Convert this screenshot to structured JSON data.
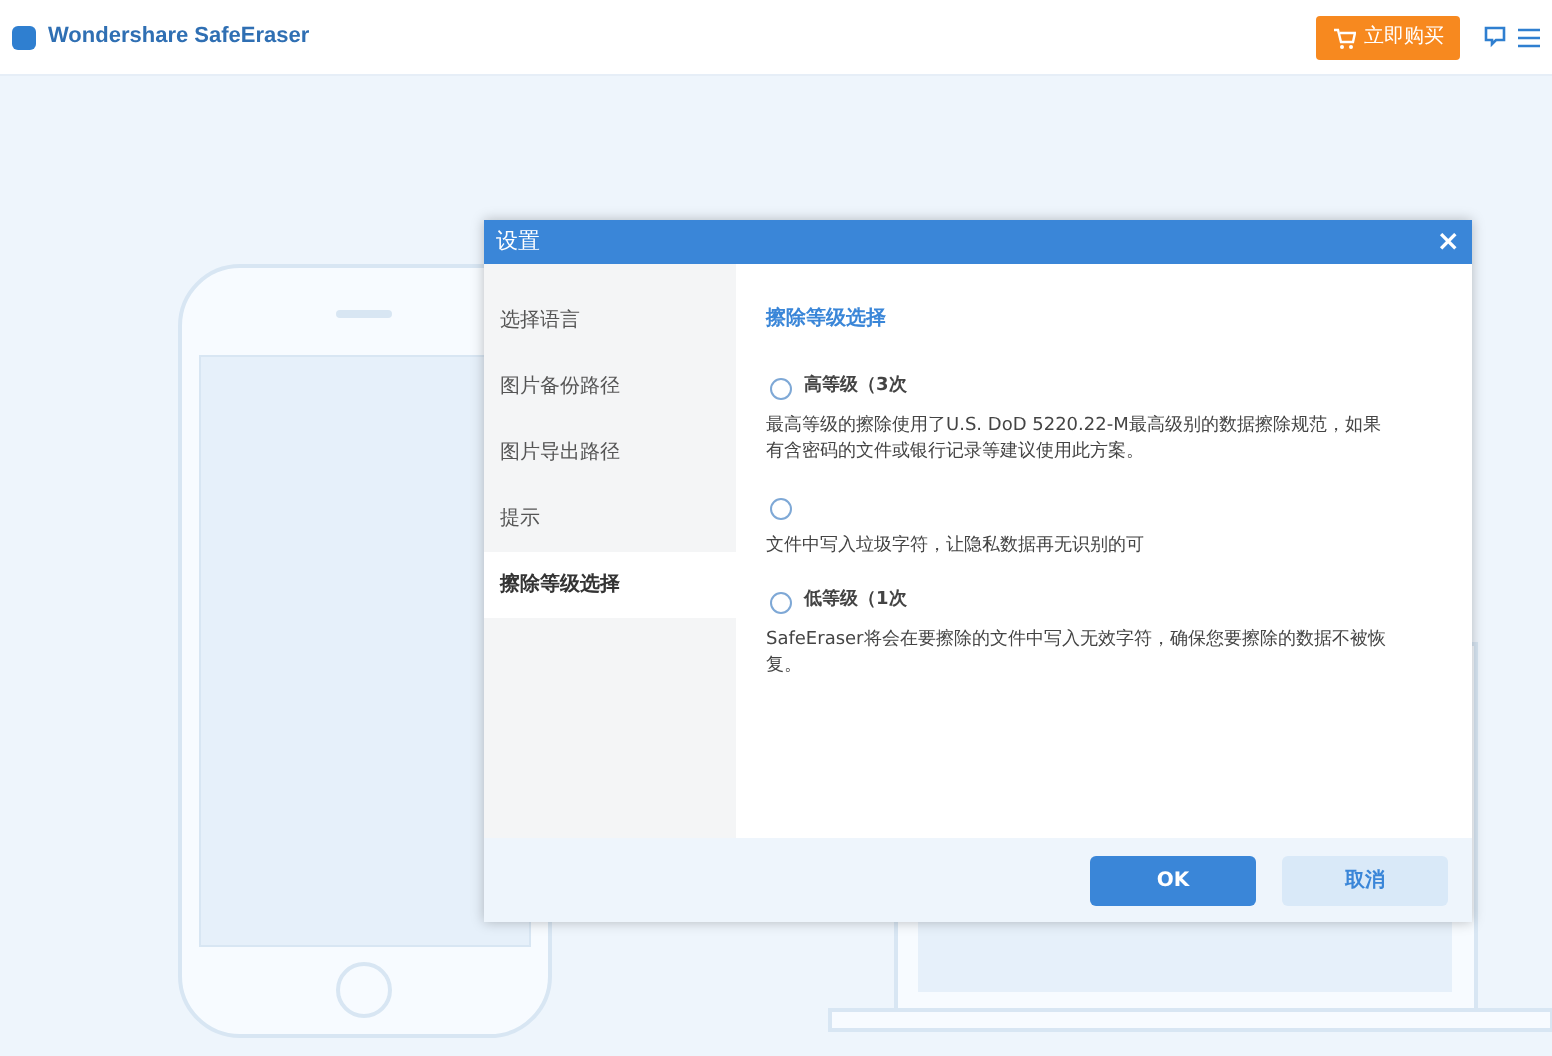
{
  "app": {
    "title": "Wondershare SafeEraser",
    "buy_button": "立即购买"
  },
  "dialog": {
    "title": "设置",
    "close": "×",
    "sidebar": [
      {
        "label": "选择语言",
        "selected": false
      },
      {
        "label": "图片备份路径",
        "selected": false
      },
      {
        "label": "图片导出路径",
        "selected": false
      },
      {
        "label": "提示",
        "selected": false
      },
      {
        "label": "擦除等级选择",
        "selected": true
      }
    ],
    "section_title": "擦除等级选择",
    "options": [
      {
        "label": "高等级（3次",
        "description": "最高等级的擦除使用了U.S. DoD 5220.22-M最高级别的数据擦除规范，如果有含密码的文件或银行记录等建议使用此方案。",
        "selected": false
      },
      {
        "description": "文件中写入垃圾字符，让隐私数据再无识别的可",
        "selected": false
      },
      {
        "label": "低等级（1次",
        "description": "SafeEraser将会在要擦除的文件中写入无效字符，确保您要擦除的数据不被恢复。",
        "selected": false
      }
    ],
    "buttons": [
      {
        "label": "OK",
        "kind": "primary"
      },
      {
        "label": "取消",
        "kind": "secondary"
      }
    ]
  }
}
